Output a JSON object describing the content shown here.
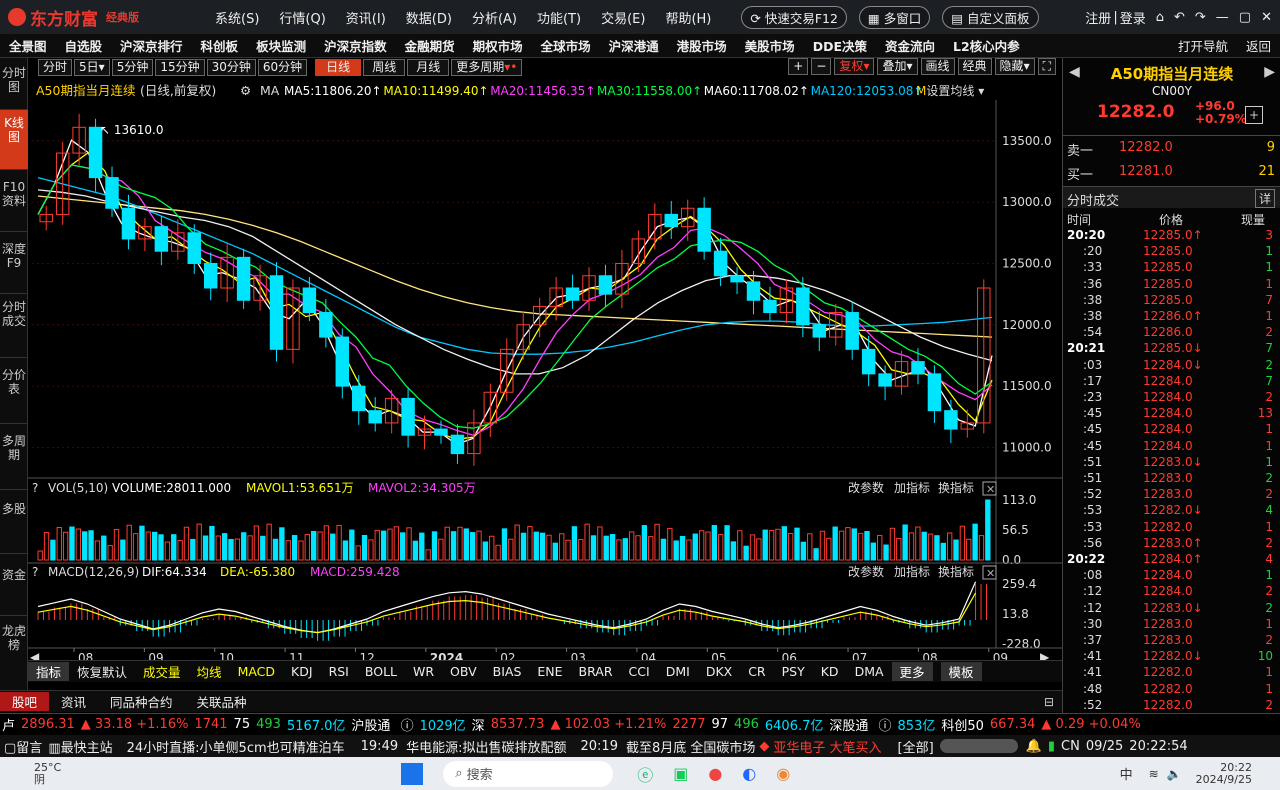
{
  "app": {
    "logo": "东方财富",
    "edition": "经典版",
    "menus": [
      "系统(S)",
      "行情(Q)",
      "资讯(I)",
      "数据(D)",
      "分析(A)",
      "功能(T)",
      "交易(E)",
      "帮助(H)"
    ],
    "quick_trade": "快速交易F12",
    "multi_window": "多窗口",
    "custom_panel": "自定义面板",
    "register": "注册",
    "login": "登录"
  },
  "nav": {
    "items": [
      "全景图",
      "自选股",
      "沪深京排行",
      "科创板",
      "板块监测",
      "沪深京指数",
      "金融期货",
      "期权市场",
      "全球市场",
      "沪深港通",
      "港股市场",
      "美股市场",
      "DDE决策",
      "资金流向",
      "L2核心内参"
    ],
    "open_nav": "打开导航",
    "back": "返回"
  },
  "sidebar": {
    "items": [
      {
        "label": "分时图",
        "active": false
      },
      {
        "label": "K线图",
        "active": true
      },
      {
        "label": "F10资料",
        "active": false
      },
      {
        "label": "深度F9",
        "active": false
      },
      {
        "label": "分时成交",
        "active": false
      },
      {
        "label": "分价表",
        "active": false
      },
      {
        "label": "多周期",
        "active": false
      },
      {
        "label": "多股",
        "active": false
      },
      {
        "label": "资金",
        "active": false
      },
      {
        "label": "龙虎榜",
        "active": false
      }
    ]
  },
  "periodbar": {
    "items": [
      {
        "label": "分时",
        "active": false
      },
      {
        "label": "5日",
        "active": false
      },
      {
        "label": "5分钟",
        "active": false
      },
      {
        "label": "15分钟",
        "active": false
      },
      {
        "label": "30分钟",
        "active": false
      },
      {
        "label": "60分钟",
        "active": false
      },
      {
        "label": "日线",
        "active": true
      },
      {
        "label": "周线",
        "active": false
      },
      {
        "label": "月线",
        "active": false
      },
      {
        "label": "更多周期",
        "active": false
      }
    ],
    "right": [
      "复权",
      "叠加",
      "画线",
      "经典",
      "隐藏"
    ]
  },
  "chart_data": {
    "type": "candlestick",
    "title": "A50期指当月连续",
    "subtitle": "(日线,前复权)",
    "ma_legend": [
      {
        "name": "MA5",
        "value": "11806.20",
        "color": "#ffffff"
      },
      {
        "name": "MA10",
        "value": "11499.40",
        "color": "#ffff00"
      },
      {
        "name": "MA20",
        "value": "11456.35",
        "color": "#ff40ff"
      },
      {
        "name": "MA30",
        "value": "11558.00",
        "color": "#00ff40"
      },
      {
        "name": "MA60",
        "value": "11708.02",
        "color": "#ffffff"
      },
      {
        "name": "MA120",
        "value": "12053.08",
        "color": "#00c8ff"
      }
    ],
    "ma_set": "设置均线",
    "price_axis": [
      "13500.0",
      "13000.0",
      "12500.0",
      "12000.0",
      "11500.0",
      "11000.0"
    ],
    "ylim": [
      10800,
      13800
    ],
    "high_label": "13610.0",
    "x_labels": [
      "08",
      "09",
      "10",
      "11",
      "12",
      "2024",
      "02",
      "03",
      "04",
      "05",
      "06",
      "07",
      "08",
      "09"
    ],
    "close_series": [
      12900,
      13400,
      13610,
      13200,
      12950,
      12700,
      12800,
      12600,
      12750,
      12500,
      12300,
      12550,
      12200,
      12400,
      11800,
      12300,
      12100,
      11900,
      11500,
      11300,
      11200,
      11400,
      11100,
      11150,
      11100,
      10950,
      11200,
      11450,
      11800,
      12000,
      12150,
      12300,
      12200,
      12400,
      12250,
      12500,
      12700,
      12900,
      12800,
      12950,
      12600,
      12400,
      12350,
      12200,
      12100,
      12300,
      12000,
      11900,
      12100,
      11800,
      11600,
      11500,
      11700,
      11600,
      11300,
      11150,
      11200,
      12300
    ],
    "ma_lines": {
      "ma120": [
        13200,
        13150,
        13100,
        13050,
        12980,
        12900,
        12820,
        12740,
        12660,
        12580,
        12480,
        12380,
        12280,
        12180,
        12080,
        11980,
        11900,
        11850,
        11800,
        11770,
        11760,
        11760,
        11770,
        11790,
        11820,
        11860,
        11910,
        11960,
        12000,
        12020,
        12030,
        12030,
        12020,
        12000,
        11990,
        11990,
        12000,
        12010,
        12020,
        12040,
        12060
      ],
      "ma60": [
        13100,
        13080,
        13050,
        13000,
        12960,
        12920,
        12880,
        12850,
        12800,
        12720,
        12600,
        12480,
        12360,
        12240,
        12120,
        12000,
        11900,
        11800,
        11720,
        11650,
        11600,
        11600,
        11650,
        11750,
        11900,
        12050,
        12180,
        12280,
        12360,
        12400,
        12400,
        12380,
        12340,
        12280,
        12200,
        12100,
        12000,
        11900,
        11820,
        11760,
        11708
      ],
      "ma200": [
        13050,
        13030,
        13010,
        12990,
        12970,
        12950,
        12930,
        12900,
        12860,
        12810,
        12750,
        12680,
        12600,
        12520,
        12440,
        12360,
        12290,
        12230,
        12180,
        12140,
        12110,
        12090,
        12080,
        12070,
        12060,
        12050,
        12040,
        12030,
        12020,
        12010,
        12000,
        11990,
        11980,
        11970,
        11960,
        11950,
        11940,
        11930,
        11920,
        11910,
        11900
      ]
    },
    "vol_legend": {
      "label": "VOL(5,10)",
      "volume": "VOLUME:28011.000",
      "mavol1": "MAVOL1:53.651万",
      "mavol2": "MAVOL2:34.305万"
    },
    "vol_axis": [
      "113.0",
      "56.5",
      "0.0"
    ],
    "macd_legend": {
      "label": "MACD(12,26,9)",
      "dif": "DIF:64.334",
      "dea": "DEA:-65.380",
      "macd": "MACD:259.428"
    },
    "macd_axis": [
      "259.4",
      "13.8",
      "-228.0"
    ],
    "macd_hist": [
      60,
      90,
      120,
      80,
      20,
      -40,
      -80,
      -120,
      -90,
      -40,
      10,
      40,
      20,
      -20,
      -60,
      -100,
      -130,
      -150,
      -120,
      -80,
      -40,
      20,
      60,
      100,
      140,
      170,
      180,
      160,
      120,
      80,
      40,
      0,
      -30,
      -60,
      -90,
      -110,
      -80,
      -40,
      30,
      80,
      60,
      20,
      -10,
      -40,
      -80,
      -110,
      -90,
      -60,
      -20,
      20,
      60,
      30,
      -20,
      -60,
      -90,
      -70,
      -40,
      259
    ],
    "panel_tools": [
      "改参数",
      "加指标",
      "换指标"
    ]
  },
  "indicators": {
    "items": [
      "指标",
      "恢复默认",
      "成交量",
      "均线",
      "MACD",
      "KDJ",
      "RSI",
      "BOLL",
      "WR",
      "OBV",
      "BIAS",
      "ENE",
      "BRAR",
      "CCI",
      "DMI",
      "DKX",
      "CR",
      "PSY",
      "KD",
      "DMA",
      "更多",
      "模板"
    ]
  },
  "bottom_tabs": [
    "股吧",
    "资讯",
    "同品种合约",
    "关联品种"
  ],
  "quote": {
    "name": "A50期指当月连续",
    "code": "CN00Y",
    "price": "12282.0",
    "change": "+96.0",
    "change_pct": "+0.79%",
    "ask_label": "卖一",
    "ask_price": "12282.0",
    "ask_vol": "9",
    "bid_label": "买一",
    "bid_price": "12281.0",
    "bid_vol": "21",
    "trades_title": "分时成交",
    "detail": "详",
    "col_time": "时间",
    "col_price": "价格",
    "col_vol": "现量",
    "trades": [
      {
        "t": "20:20",
        "p": "12285.0↑",
        "v": "3",
        "c": "red"
      },
      {
        "t": ":20",
        "p": "12285.0",
        "v": "1",
        "c": "green"
      },
      {
        "t": ":33",
        "p": "12285.0",
        "v": "1",
        "c": "green"
      },
      {
        "t": ":36",
        "p": "12285.0",
        "v": "1",
        "c": "red"
      },
      {
        "t": ":38",
        "p": "12285.0",
        "v": "7",
        "c": "red"
      },
      {
        "t": ":38",
        "p": "12286.0↑",
        "v": "1",
        "c": "red"
      },
      {
        "t": ":54",
        "p": "12286.0",
        "v": "2",
        "c": "red"
      },
      {
        "t": "20:21",
        "p": "12285.0↓",
        "v": "7",
        "c": "green"
      },
      {
        "t": ":03",
        "p": "12284.0↓",
        "v": "2",
        "c": "green"
      },
      {
        "t": ":17",
        "p": "12284.0",
        "v": "7",
        "c": "green"
      },
      {
        "t": ":23",
        "p": "12284.0",
        "v": "2",
        "c": "red"
      },
      {
        "t": ":45",
        "p": "12284.0",
        "v": "13",
        "c": "red"
      },
      {
        "t": ":45",
        "p": "12284.0",
        "v": "1",
        "c": "red"
      },
      {
        "t": ":45",
        "p": "12284.0",
        "v": "1",
        "c": "red"
      },
      {
        "t": ":51",
        "p": "12283.0↓",
        "v": "1",
        "c": "green"
      },
      {
        "t": ":51",
        "p": "12283.0",
        "v": "2",
        "c": "green"
      },
      {
        "t": ":52",
        "p": "12283.0",
        "v": "2",
        "c": "red"
      },
      {
        "t": ":53",
        "p": "12282.0↓",
        "v": "4",
        "c": "green"
      },
      {
        "t": ":53",
        "p": "12282.0",
        "v": "1",
        "c": "red"
      },
      {
        "t": ":56",
        "p": "12283.0↑",
        "v": "2",
        "c": "red"
      },
      {
        "t": "20:22",
        "p": "12284.0↑",
        "v": "4",
        "c": "red"
      },
      {
        "t": ":08",
        "p": "12284.0",
        "v": "1",
        "c": "green"
      },
      {
        "t": ":12",
        "p": "12284.0",
        "v": "2",
        "c": "red"
      },
      {
        "t": ":12",
        "p": "12283.0↓",
        "v": "2",
        "c": "green"
      },
      {
        "t": ":30",
        "p": "12283.0",
        "v": "1",
        "c": "red"
      },
      {
        "t": ":37",
        "p": "12283.0",
        "v": "2",
        "c": "red"
      },
      {
        "t": ":41",
        "p": "12282.0↓",
        "v": "10",
        "c": "green"
      },
      {
        "t": ":41",
        "p": "12282.0",
        "v": "1",
        "c": "red"
      },
      {
        "t": ":48",
        "p": "12282.0",
        "v": "1",
        "c": "red"
      },
      {
        "t": ":52",
        "p": "12282.0",
        "v": "2",
        "c": "red"
      }
    ]
  },
  "indexstrip": {
    "sh_val": "2896.31",
    "sh_chg": "▲ 33.18 +1.16%",
    "sh_up": "1741",
    "sh_flat": "75",
    "sh_down": "493",
    "sh_amt": "5167.0亿",
    "hgt_label": "沪股通",
    "hgt_val": "1029亿",
    "sz_label": "深",
    "sz_val": "8537.73",
    "sz_chg": "▲ 102.03 +1.21%",
    "sz_up": "2277",
    "sz_flat": "97",
    "sz_down": "496",
    "sz_amt": "6406.7亿",
    "sgt_label": "深股通",
    "sgt_val": "853亿",
    "kc_label": "科创50",
    "kc_val": "667.34",
    "kc_chg": "▲ 0.29 +0.04%"
  },
  "news": {
    "msg": "留言",
    "main": "最快主站",
    "n1": "24小时直播:小单侧5cm也可精准泊车",
    "t2": "19:49",
    "n2": "华电能源:拟出售碳排放配额",
    "t3": "20:19",
    "n3": "截至8月底 全国碳市场",
    "n4": "亚华电子 大笔买入",
    "all": "[全部]",
    "net": "CN",
    "date": "09/25",
    "time": "20:22:54"
  },
  "taskbar": {
    "temp": "25°C",
    "weather": "阴",
    "search": "搜索",
    "lang": "中",
    "clock": "20:22",
    "date": "2024/9/25"
  }
}
